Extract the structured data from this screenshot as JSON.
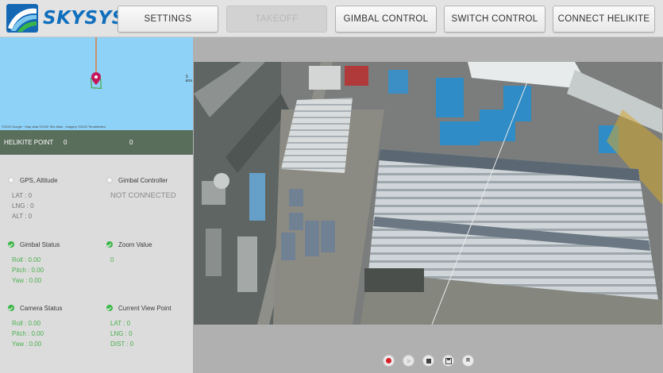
{
  "brand": {
    "name": "SKYSYS"
  },
  "toolbar": {
    "settings": "SETTINGS",
    "takeoff": "TAKEOFF",
    "gimbal_control": "GIMBAL CONTROL",
    "switch_control": "SWITCH CONTROL",
    "connect_helikite": "CONNECT HELIKITE"
  },
  "map": {
    "credit": "©2020 Google · Map data ©2020 Tele Atlas , Imagery ©2020 TerraMetrics",
    "edge_label": "S\nana"
  },
  "helikite_point": {
    "label": "HELIKITE POINT",
    "value1": "0",
    "value2": "0"
  },
  "status": {
    "gps": {
      "title": "GPS, Altitude",
      "lat": "LAT : 0",
      "lng": "LNG : 0",
      "alt": "ALT : 0",
      "ok": false
    },
    "gimbal_controller": {
      "title": "Gimbal Controller",
      "state": "NOT CONNECTED",
      "ok": false
    },
    "gimbal_status": {
      "title": "Gimbal Status",
      "roll": "Roll : 0.00",
      "pitch": "Pitch : 0.00",
      "yaw": "Yaw : 0.00",
      "ok": true
    },
    "zoom": {
      "title": "Zoom Value",
      "value": "0",
      "ok": true
    },
    "camera_status": {
      "title": "Camera Status",
      "roll": "Roll : 0.00",
      "pitch": "Pitch : 0.00",
      "yaw": "Yaw : 0.00",
      "ok": true
    },
    "current_view": {
      "title": "Current View Point",
      "lat": "LAT : 0",
      "lng": "LNG : 0",
      "dist": "DIST : 0",
      "ok": true
    }
  },
  "video": {
    "content": "aerial view of industrial factory complex"
  },
  "controls": {
    "record": "record-icon",
    "play": "play-icon",
    "stop": "stop-icon",
    "save": "save-icon",
    "reset_label": "R"
  },
  "colors": {
    "brand_blue": "#0f6fbd",
    "status_green": "#3db54a",
    "record_red": "#d9202a",
    "map_water": "#8fd2f7",
    "heli_bar": "#5a6e5c"
  }
}
